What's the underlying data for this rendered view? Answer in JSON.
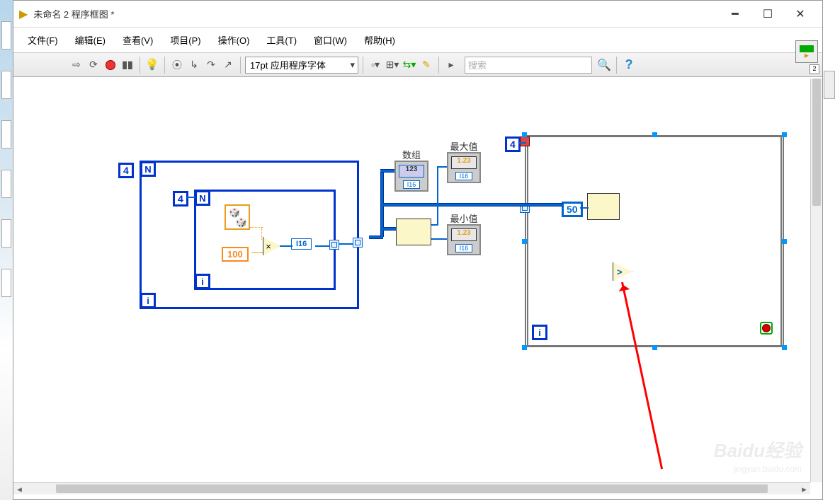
{
  "window": {
    "title": "未命名 2 程序框图 *"
  },
  "menu": {
    "file": "文件(F)",
    "edit": "编辑(E)",
    "view": "查看(V)",
    "project": "项目(P)",
    "operate": "操作(O)",
    "tools": "工具(T)",
    "window": "窗口(W)",
    "help": "帮助(H)"
  },
  "toolbar": {
    "font": "17pt 应用程序字体",
    "search_placeholder": "搜索",
    "palette_sub": "2"
  },
  "diagram": {
    "outer_loop_count": "4",
    "inner_loop_count": "4",
    "loop_N": "N",
    "loop_i": "i",
    "const100": "100",
    "i16": "I16",
    "array": {
      "label": "数组",
      "sample": "123",
      "footer": "I16"
    },
    "max": {
      "label": "最大值",
      "value": "1.23",
      "footer": "I16"
    },
    "min": {
      "label": "最小值",
      "value": "1.23",
      "footer": "I16"
    },
    "while_count": "4",
    "const50": "50",
    "gt": ">"
  },
  "watermark": {
    "main": "Baidu经验",
    "sub": "jingyan.baidu.com"
  }
}
